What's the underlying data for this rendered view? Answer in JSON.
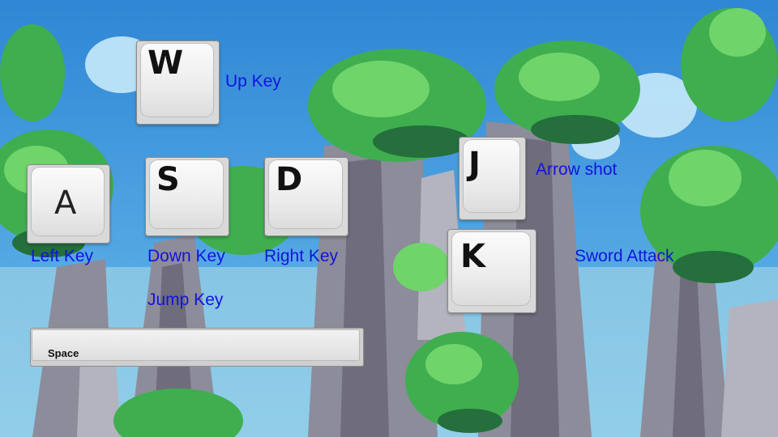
{
  "colors": {
    "sky": "#2f8fd8",
    "sky_light": "#9fd6f3",
    "foliage": "#4fbf5a",
    "foliage_dark": "#2e8b45",
    "rock": "#8c8f9e",
    "label": "#1313e0"
  },
  "keys": {
    "w": {
      "glyph": "W",
      "label": "Up Key"
    },
    "a": {
      "glyph": "A",
      "label": "Left Key"
    },
    "s": {
      "glyph": "S",
      "label": "Down Key"
    },
    "d": {
      "glyph": "D",
      "label": "Right Key"
    },
    "j": {
      "glyph": "J",
      "label": "Arrow shot"
    },
    "k": {
      "glyph": "K",
      "label": "Sword Attack"
    },
    "space": {
      "glyph": "Space",
      "label": "Jump Key"
    }
  }
}
